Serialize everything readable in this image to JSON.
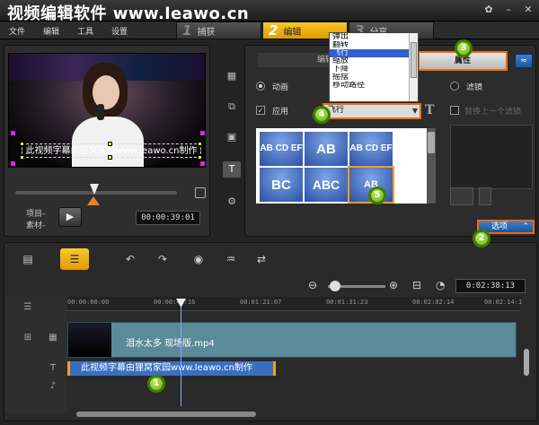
{
  "watermark": "视频编辑软件 www.leawo.cn",
  "menu": [
    "文件",
    "编辑",
    "工具",
    "设置"
  ],
  "steps": [
    {
      "num": "1",
      "label": "捕获"
    },
    {
      "num": "2",
      "label": "编辑"
    },
    {
      "num": "3",
      "label": "分享"
    }
  ],
  "preview": {
    "overlay_text": "此视频字幕由狸窝家园www.leawo.cn制作",
    "mode_project": "项目-",
    "mode_clip": "素材-",
    "timecode": "00:00:39:01"
  },
  "options": {
    "edit_tab": "编辑",
    "attr_tab": "属性",
    "animation_label": "动画",
    "filter_label": "滤镜",
    "apply_label": "应用",
    "replace_filter_label": "替换上一个滤镜",
    "selected_animation": "飞行",
    "dropdown_items": [
      "弹出",
      "翻转",
      "飞行",
      "缩放",
      "下降",
      "摇摆",
      "移动路径"
    ],
    "options_button": "选项",
    "presets": [
      "AB CD EF",
      "AB",
      "AB CD EF",
      "BC",
      "ABC",
      "AB"
    ]
  },
  "markers": [
    "1",
    "2",
    "3",
    "4",
    "5"
  ],
  "timeline": {
    "duration": "0:02:38:13",
    "ruler": [
      "00:00:00:00",
      "00:00:40:16",
      "00:01:21:07",
      "00:01:31:23",
      "00:02:02:14",
      "00:02:14:1"
    ],
    "video_clip": "泪水太多 现场版.mp4",
    "title_clip": "此视频字幕由狸窝家园www.leawo.cn制作"
  }
}
